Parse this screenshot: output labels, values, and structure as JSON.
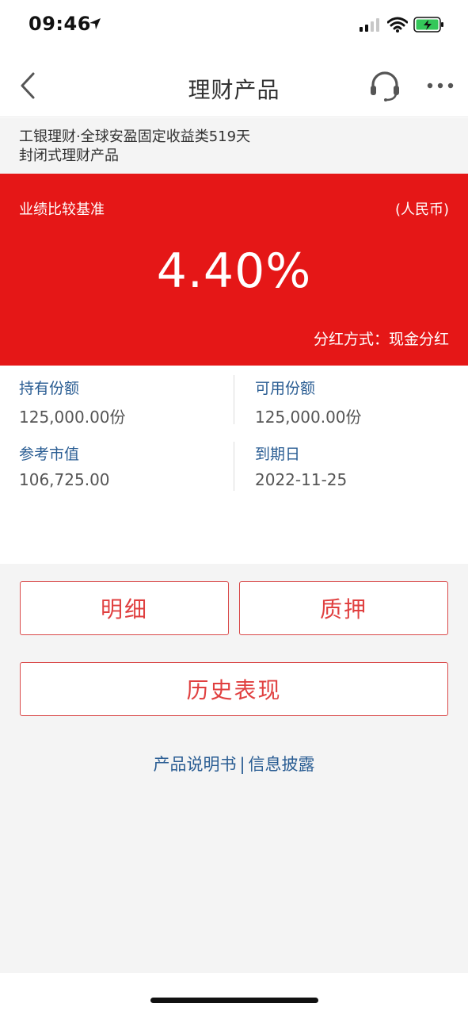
{
  "status_bar": {
    "time": "09:46",
    "icons": [
      "location-arrow-icon",
      "signal-icon",
      "wifi-icon",
      "battery-charging-icon"
    ]
  },
  "nav": {
    "title": "理财产品",
    "icons": [
      "back-icon",
      "headset-icon",
      "more-icon"
    ]
  },
  "product": {
    "name_line1": "工银理财·全球安盈固定收益类519天",
    "name_line2": "封闭式理财产品"
  },
  "banner": {
    "rate_label": "业绩比较基准",
    "currency": "(人民币)",
    "rate_value": "4.40%",
    "dividend_label": "分红方式：",
    "dividend_value": "现金分红",
    "color": "#e51717"
  },
  "holdings": {
    "held_label": "持有份额",
    "held_value": "125,000.00份",
    "available_label": "可用份额",
    "available_value": "125,000.00份",
    "market_label": "参考市值",
    "market_value": "106,725.00",
    "maturity_label": "到期日",
    "maturity_value": "2022-11-25"
  },
  "actions": {
    "detail_label": "明细",
    "pledge_label": "质押",
    "history_label": "历史表现"
  },
  "links": {
    "prospectus": "产品说明书",
    "separator": "|",
    "disclosure": "信息披露"
  },
  "colors": {
    "accent_red": "#e04040",
    "link_blue": "#2a5d93"
  }
}
